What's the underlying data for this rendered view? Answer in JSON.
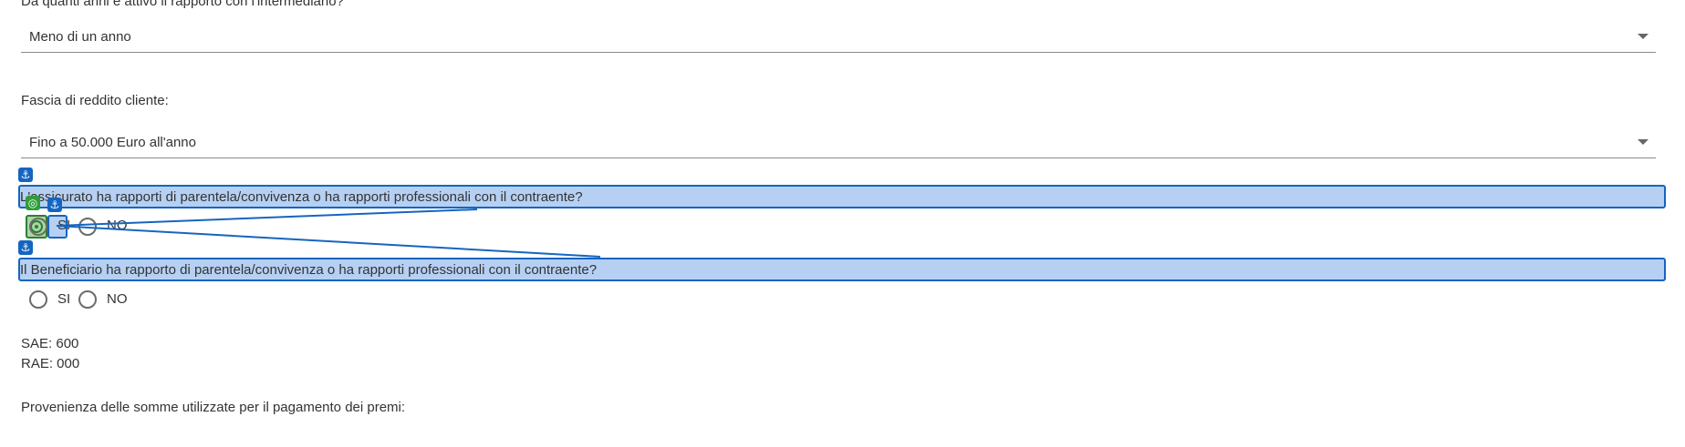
{
  "q_years": {
    "label": "Da quanti anni è attivo il rapporto con l'intermediario?",
    "value": "Meno di un anno"
  },
  "q_income": {
    "label": "Fascia di reddito cliente:",
    "value": "Fino a 50.000 Euro all'anno"
  },
  "q_insured": {
    "label": "L'assicurato ha rapporti di parentela/convivenza o ha rapporti professionali con il contraente?",
    "opt_si": "SI",
    "opt_no": "NO"
  },
  "q_beneficiary": {
    "label": "Il Beneficiario ha rapporto di parentela/convivenza o ha rapporti professionali con il contraente?",
    "opt_si": "SI",
    "opt_no": "NO"
  },
  "codes": {
    "sae": "SAE: 600",
    "rae": "RAE: 000"
  },
  "q_funds": {
    "label": "Provenienza delle somme utilizzate per il pagamento dei premi:"
  },
  "overlay": {
    "anchor_icon": "⚓",
    "target_icon": "◎",
    "highlight_color": "#b6d0f3",
    "border_color": "#1565c0",
    "target_color": "#2e9d3a"
  }
}
